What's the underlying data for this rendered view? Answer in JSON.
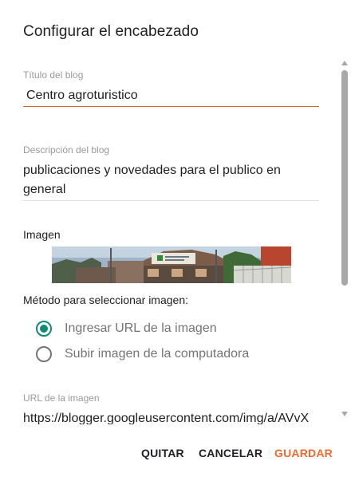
{
  "dialog": {
    "title": "Configurar el encabezado",
    "blog_title": {
      "label": "Título del blog",
      "value": "Centro agroturistico"
    },
    "blog_description": {
      "label": "Descripción del blog",
      "value_line1": "publicaciones y novedades para el publico en",
      "value_line2": "general"
    },
    "image": {
      "label": "Imagen"
    },
    "method": {
      "label": "Método para seleccionar imagen:",
      "options": [
        {
          "label": "Ingresar URL de la imagen",
          "selected": true
        },
        {
          "label": "Subir imagen de la computadora",
          "selected": false
        }
      ]
    },
    "image_url": {
      "label": "URL de la imagen",
      "value": "https://blogger.googleusercontent.com/img/a/AVvX"
    },
    "actions": {
      "remove": "QUITAR",
      "cancel": "CANCELAR",
      "save": "GUARDAR"
    }
  },
  "colors": {
    "accent": "#f26a2e",
    "radio_checked": "#138a72",
    "title_underline": "#d66a2d"
  }
}
